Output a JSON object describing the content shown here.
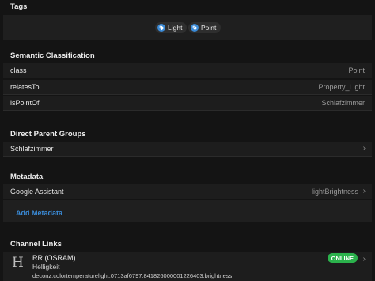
{
  "tags": {
    "title": "Tags",
    "items": [
      {
        "label": "Light",
        "icon": "tag-icon"
      },
      {
        "label": "Point",
        "icon": "tag-icon"
      }
    ]
  },
  "semantic": {
    "title": "Semantic Classification",
    "rows": [
      {
        "key": "class",
        "value": "Point"
      },
      {
        "key": "relatesTo",
        "value": "Property_Light"
      },
      {
        "key": "isPointOf",
        "value": "Schlafzimmer"
      }
    ]
  },
  "parent_groups": {
    "title": "Direct Parent Groups",
    "items": [
      {
        "label": "Schlafzimmer",
        "icon": "chevron-right-icon"
      }
    ]
  },
  "metadata": {
    "title": "Metadata",
    "rows": [
      {
        "key": "Google Assistant",
        "value": "lightBrightness",
        "icon": "chevron-right-icon"
      }
    ],
    "add_label": "Add Metadata"
  },
  "channel_links": {
    "title": "Channel Links",
    "items": [
      {
        "icon_letter": "H",
        "title": "RR (OSRAM)",
        "subtitle": "Helligkeit",
        "uid": "deconz:colortemperaturelight:0713af6797:841826000001226403:brightness",
        "status": "ONLINE",
        "status_color": "#2bb24c"
      }
    ]
  },
  "colors": {
    "background": "#141414",
    "row": "#1d1d1d",
    "accent": "#3a8ad6",
    "online": "#2bb24c"
  }
}
